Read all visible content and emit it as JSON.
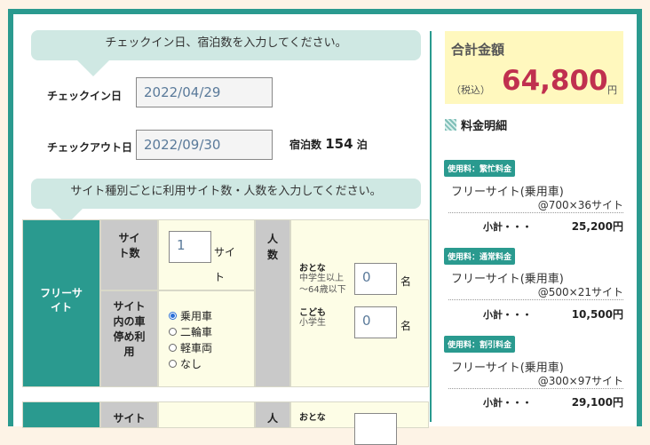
{
  "checkin_bubble": "チェックイン日、宿泊数を入力してください。",
  "checkin": {
    "label": "チェックイン日",
    "value": "2022/04/29"
  },
  "checkout": {
    "label": "チェックアウト日",
    "value": "2022/09/30"
  },
  "nights": {
    "label": "宿泊数",
    "value": "154",
    "unit": "泊"
  },
  "site_bubble": "サイト種別ごとに利用サイト数・人数を入力してください。",
  "site_table": {
    "type_name": "フリーサイト",
    "count_label": "サイト数",
    "count_value": "1",
    "count_unit": "サイト",
    "people_label": "人数",
    "adult_label": "おとな",
    "adult_sub": "中学生以上\n〜64歳以下",
    "adult_value": "0",
    "child_label": "こども",
    "child_sub": "小学生",
    "child_value": "0",
    "person_unit": "名",
    "parking_label": "サイト内の車停め利用",
    "parking_options": [
      "乗用車",
      "二輪車",
      "軽車両",
      "なし"
    ],
    "parking_selected": "乗用車",
    "next_row_count_label": "サイト",
    "next_row_people_label": "人",
    "next_row_adult_label": "おとな"
  },
  "total": {
    "title": "合計金額",
    "tax_label": "（税込）",
    "amount": "64,800",
    "yen": "円"
  },
  "breakdown_title": "料金明細",
  "breakdown": [
    {
      "tag": "使用料：繁忙料金",
      "item": "フリーサイト(乗用車)",
      "calc": "@700×36サイト",
      "subtotal_label": "小計・・・",
      "subtotal": "25,200円"
    },
    {
      "tag": "使用料：通常料金",
      "item": "フリーサイト(乗用車)",
      "calc": "@500×21サイト",
      "subtotal_label": "小計・・・",
      "subtotal": "10,500円"
    },
    {
      "tag": "使用料：割引料金",
      "item": "フリーサイト(乗用車)",
      "calc": "@300×97サイト",
      "subtotal_label": "小計・・・",
      "subtotal": "29,100円"
    }
  ],
  "colors": {
    "accent": "#2a9a8f",
    "amount": "#c0304f",
    "total_bg": "#fff8be"
  }
}
